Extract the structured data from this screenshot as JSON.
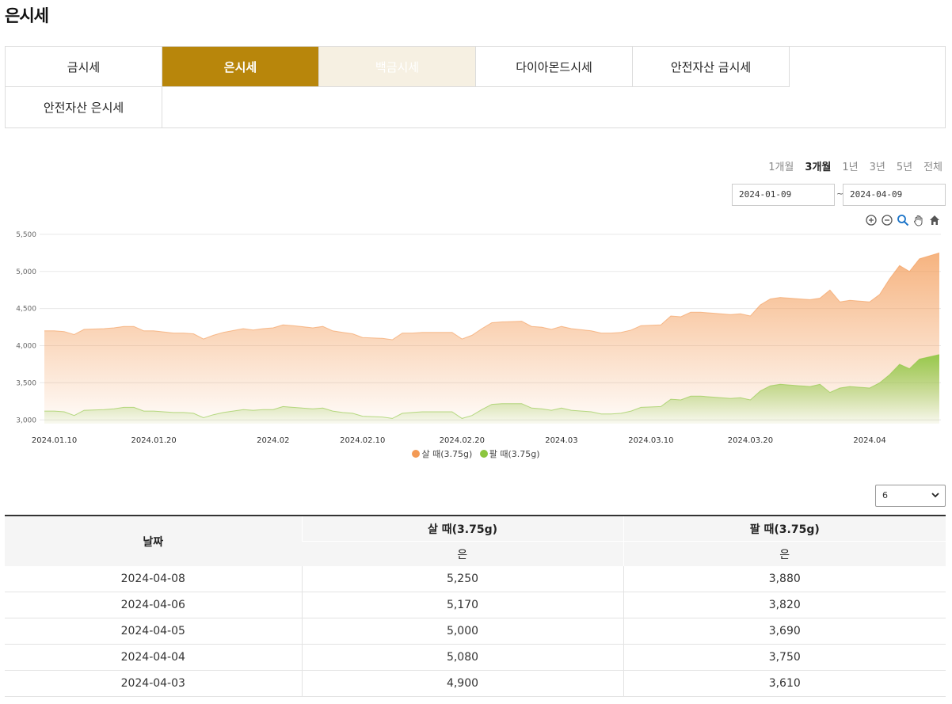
{
  "page": {
    "title": "은시세"
  },
  "tabs": [
    {
      "label": "금시세",
      "state": "normal"
    },
    {
      "label": "은시세",
      "state": "active"
    },
    {
      "label": "백금시세",
      "state": "disabled"
    },
    {
      "label": "다이아몬드시세",
      "state": "normal"
    },
    {
      "label": "안전자산 금시세",
      "state": "normal"
    },
    {
      "label": "안전자산 은시세",
      "state": "normal"
    }
  ],
  "period_buttons": [
    {
      "label": "1개월",
      "selected": false
    },
    {
      "label": "3개월",
      "selected": true
    },
    {
      "label": "1년",
      "selected": false
    },
    {
      "label": "3년",
      "selected": false
    },
    {
      "label": "5년",
      "selected": false
    },
    {
      "label": "전체",
      "selected": false
    }
  ],
  "date_range": {
    "start": "2024-01-09",
    "separator": "~",
    "end": "2024-04-09"
  },
  "chart_tools": [
    "zoom-in-icon",
    "zoom-out-icon",
    "magnifier-icon",
    "pan-hand-icon",
    "home-icon"
  ],
  "chart_data": {
    "type": "area",
    "x_tick_labels": [
      "2024.01.10",
      "2024.01.20",
      "2024.02",
      "2024.02.10",
      "2024.02.20",
      "2024.03",
      "2024.03.10",
      "2024.03.20",
      "2024.04"
    ],
    "x_ticks": [
      "2024-01-10",
      "2024-01-20",
      "2024-02-01",
      "2024-02-10",
      "2024-02-20",
      "2024-03-01",
      "2024-03-10",
      "2024-03-20",
      "2024-04-01"
    ],
    "y_ticks": [
      3000,
      3500,
      4000,
      4500,
      5000,
      5500
    ],
    "y_tick_labels": [
      "3,000",
      "3,500",
      "4,000",
      "4,500",
      "5,000",
      "5,500"
    ],
    "ylim": [
      2950,
      5520
    ],
    "xlim": [
      "2024-01-09",
      "2024-04-08"
    ],
    "grid": true,
    "legend_position": "bottom",
    "colors": {
      "buy": "#f39a55",
      "sell": "#8cc63f"
    },
    "series": [
      {
        "name": "살 때(3.75g)",
        "key": "buy",
        "points": [
          [
            "2024-01-09",
            4200
          ],
          [
            "2024-01-10",
            4200
          ],
          [
            "2024-01-11",
            4190
          ],
          [
            "2024-01-12",
            4150
          ],
          [
            "2024-01-13",
            4220
          ],
          [
            "2024-01-15",
            4230
          ],
          [
            "2024-01-16",
            4240
          ],
          [
            "2024-01-17",
            4260
          ],
          [
            "2024-01-18",
            4260
          ],
          [
            "2024-01-19",
            4200
          ],
          [
            "2024-01-20",
            4200
          ],
          [
            "2024-01-22",
            4170
          ],
          [
            "2024-01-23",
            4170
          ],
          [
            "2024-01-24",
            4160
          ],
          [
            "2024-01-25",
            4090
          ],
          [
            "2024-01-26",
            4140
          ],
          [
            "2024-01-27",
            4180
          ],
          [
            "2024-01-29",
            4230
          ],
          [
            "2024-01-30",
            4210
          ],
          [
            "2024-01-31",
            4230
          ],
          [
            "2024-02-01",
            4240
          ],
          [
            "2024-02-02",
            4280
          ],
          [
            "2024-02-03",
            4270
          ],
          [
            "2024-02-05",
            4240
          ],
          [
            "2024-02-06",
            4260
          ],
          [
            "2024-02-07",
            4200
          ],
          [
            "2024-02-08",
            4180
          ],
          [
            "2024-02-09",
            4160
          ],
          [
            "2024-02-10",
            4110
          ],
          [
            "2024-02-12",
            4100
          ],
          [
            "2024-02-13",
            4080
          ],
          [
            "2024-02-14",
            4170
          ],
          [
            "2024-02-15",
            4170
          ],
          [
            "2024-02-16",
            4180
          ],
          [
            "2024-02-17",
            4180
          ],
          [
            "2024-02-19",
            4180
          ],
          [
            "2024-02-20",
            4090
          ],
          [
            "2024-02-21",
            4140
          ],
          [
            "2024-02-22",
            4230
          ],
          [
            "2024-02-23",
            4310
          ],
          [
            "2024-02-24",
            4320
          ],
          [
            "2024-02-26",
            4330
          ],
          [
            "2024-02-27",
            4260
          ],
          [
            "2024-02-28",
            4250
          ],
          [
            "2024-02-29",
            4220
          ],
          [
            "2024-03-01",
            4260
          ],
          [
            "2024-03-02",
            4230
          ],
          [
            "2024-03-04",
            4200
          ],
          [
            "2024-03-05",
            4170
          ],
          [
            "2024-03-06",
            4170
          ],
          [
            "2024-03-07",
            4180
          ],
          [
            "2024-03-08",
            4210
          ],
          [
            "2024-03-09",
            4270
          ],
          [
            "2024-03-11",
            4280
          ],
          [
            "2024-03-12",
            4400
          ],
          [
            "2024-03-13",
            4390
          ],
          [
            "2024-03-14",
            4450
          ],
          [
            "2024-03-15",
            4450
          ],
          [
            "2024-03-16",
            4440
          ],
          [
            "2024-03-18",
            4420
          ],
          [
            "2024-03-19",
            4430
          ],
          [
            "2024-03-20",
            4400
          ],
          [
            "2024-03-21",
            4550
          ],
          [
            "2024-03-22",
            4630
          ],
          [
            "2024-03-23",
            4650
          ],
          [
            "2024-03-25",
            4630
          ],
          [
            "2024-03-26",
            4620
          ],
          [
            "2024-03-27",
            4640
          ],
          [
            "2024-03-28",
            4750
          ],
          [
            "2024-03-29",
            4590
          ],
          [
            "2024-03-30",
            4610
          ],
          [
            "2024-04-01",
            4590
          ],
          [
            "2024-04-02",
            4690
          ],
          [
            "2024-04-03",
            4900
          ],
          [
            "2024-04-04",
            5080
          ],
          [
            "2024-04-05",
            5000
          ],
          [
            "2024-04-06",
            5170
          ],
          [
            "2024-04-08",
            5250
          ]
        ]
      },
      {
        "name": "팔 때(3.75g)",
        "key": "sell",
        "points": [
          [
            "2024-01-09",
            3120
          ],
          [
            "2024-01-10",
            3120
          ],
          [
            "2024-01-11",
            3110
          ],
          [
            "2024-01-12",
            3060
          ],
          [
            "2024-01-13",
            3130
          ],
          [
            "2024-01-15",
            3140
          ],
          [
            "2024-01-16",
            3150
          ],
          [
            "2024-01-17",
            3170
          ],
          [
            "2024-01-18",
            3170
          ],
          [
            "2024-01-19",
            3120
          ],
          [
            "2024-01-20",
            3120
          ],
          [
            "2024-01-22",
            3100
          ],
          [
            "2024-01-23",
            3100
          ],
          [
            "2024-01-24",
            3090
          ],
          [
            "2024-01-25",
            3030
          ],
          [
            "2024-01-26",
            3070
          ],
          [
            "2024-01-27",
            3100
          ],
          [
            "2024-01-29",
            3140
          ],
          [
            "2024-01-30",
            3130
          ],
          [
            "2024-01-31",
            3140
          ],
          [
            "2024-02-01",
            3140
          ],
          [
            "2024-02-02",
            3180
          ],
          [
            "2024-02-03",
            3170
          ],
          [
            "2024-02-05",
            3150
          ],
          [
            "2024-02-06",
            3160
          ],
          [
            "2024-02-07",
            3120
          ],
          [
            "2024-02-08",
            3100
          ],
          [
            "2024-02-09",
            3090
          ],
          [
            "2024-02-10",
            3050
          ],
          [
            "2024-02-12",
            3040
          ],
          [
            "2024-02-13",
            3020
          ],
          [
            "2024-02-14",
            3090
          ],
          [
            "2024-02-15",
            3100
          ],
          [
            "2024-02-16",
            3110
          ],
          [
            "2024-02-17",
            3110
          ],
          [
            "2024-02-19",
            3110
          ],
          [
            "2024-02-20",
            3020
          ],
          [
            "2024-02-21",
            3060
          ],
          [
            "2024-02-22",
            3140
          ],
          [
            "2024-02-23",
            3210
          ],
          [
            "2024-02-24",
            3220
          ],
          [
            "2024-02-26",
            3220
          ],
          [
            "2024-02-27",
            3160
          ],
          [
            "2024-02-28",
            3150
          ],
          [
            "2024-02-29",
            3130
          ],
          [
            "2024-03-01",
            3160
          ],
          [
            "2024-03-02",
            3130
          ],
          [
            "2024-03-04",
            3110
          ],
          [
            "2024-03-05",
            3080
          ],
          [
            "2024-03-06",
            3080
          ],
          [
            "2024-03-07",
            3090
          ],
          [
            "2024-03-08",
            3120
          ],
          [
            "2024-03-09",
            3170
          ],
          [
            "2024-03-11",
            3180
          ],
          [
            "2024-03-12",
            3280
          ],
          [
            "2024-03-13",
            3270
          ],
          [
            "2024-03-14",
            3320
          ],
          [
            "2024-03-15",
            3320
          ],
          [
            "2024-03-16",
            3310
          ],
          [
            "2024-03-18",
            3290
          ],
          [
            "2024-03-19",
            3300
          ],
          [
            "2024-03-20",
            3270
          ],
          [
            "2024-03-21",
            3390
          ],
          [
            "2024-03-22",
            3460
          ],
          [
            "2024-03-23",
            3480
          ],
          [
            "2024-03-25",
            3460
          ],
          [
            "2024-03-26",
            3450
          ],
          [
            "2024-03-27",
            3480
          ],
          [
            "2024-03-28",
            3370
          ],
          [
            "2024-03-29",
            3430
          ],
          [
            "2024-03-30",
            3450
          ],
          [
            "2024-04-01",
            3430
          ],
          [
            "2024-04-02",
            3500
          ],
          [
            "2024-04-03",
            3610
          ],
          [
            "2024-04-04",
            3750
          ],
          [
            "2024-04-05",
            3690
          ],
          [
            "2024-04-06",
            3820
          ],
          [
            "2024-04-08",
            3880
          ]
        ]
      }
    ]
  },
  "rows_select": {
    "value": "6"
  },
  "table": {
    "headers": {
      "date": "날짜",
      "buy": "살 때(3.75g)",
      "sell": "팔 때(3.75g)",
      "buy_sub": "은",
      "sell_sub": "은"
    },
    "rows": [
      {
        "date": "2024-04-08",
        "buy": "5,250",
        "sell": "3,880"
      },
      {
        "date": "2024-04-06",
        "buy": "5,170",
        "sell": "3,820"
      },
      {
        "date": "2024-04-05",
        "buy": "5,000",
        "sell": "3,690"
      },
      {
        "date": "2024-04-04",
        "buy": "5,080",
        "sell": "3,750"
      },
      {
        "date": "2024-04-03",
        "buy": "4,900",
        "sell": "3,610"
      }
    ]
  }
}
